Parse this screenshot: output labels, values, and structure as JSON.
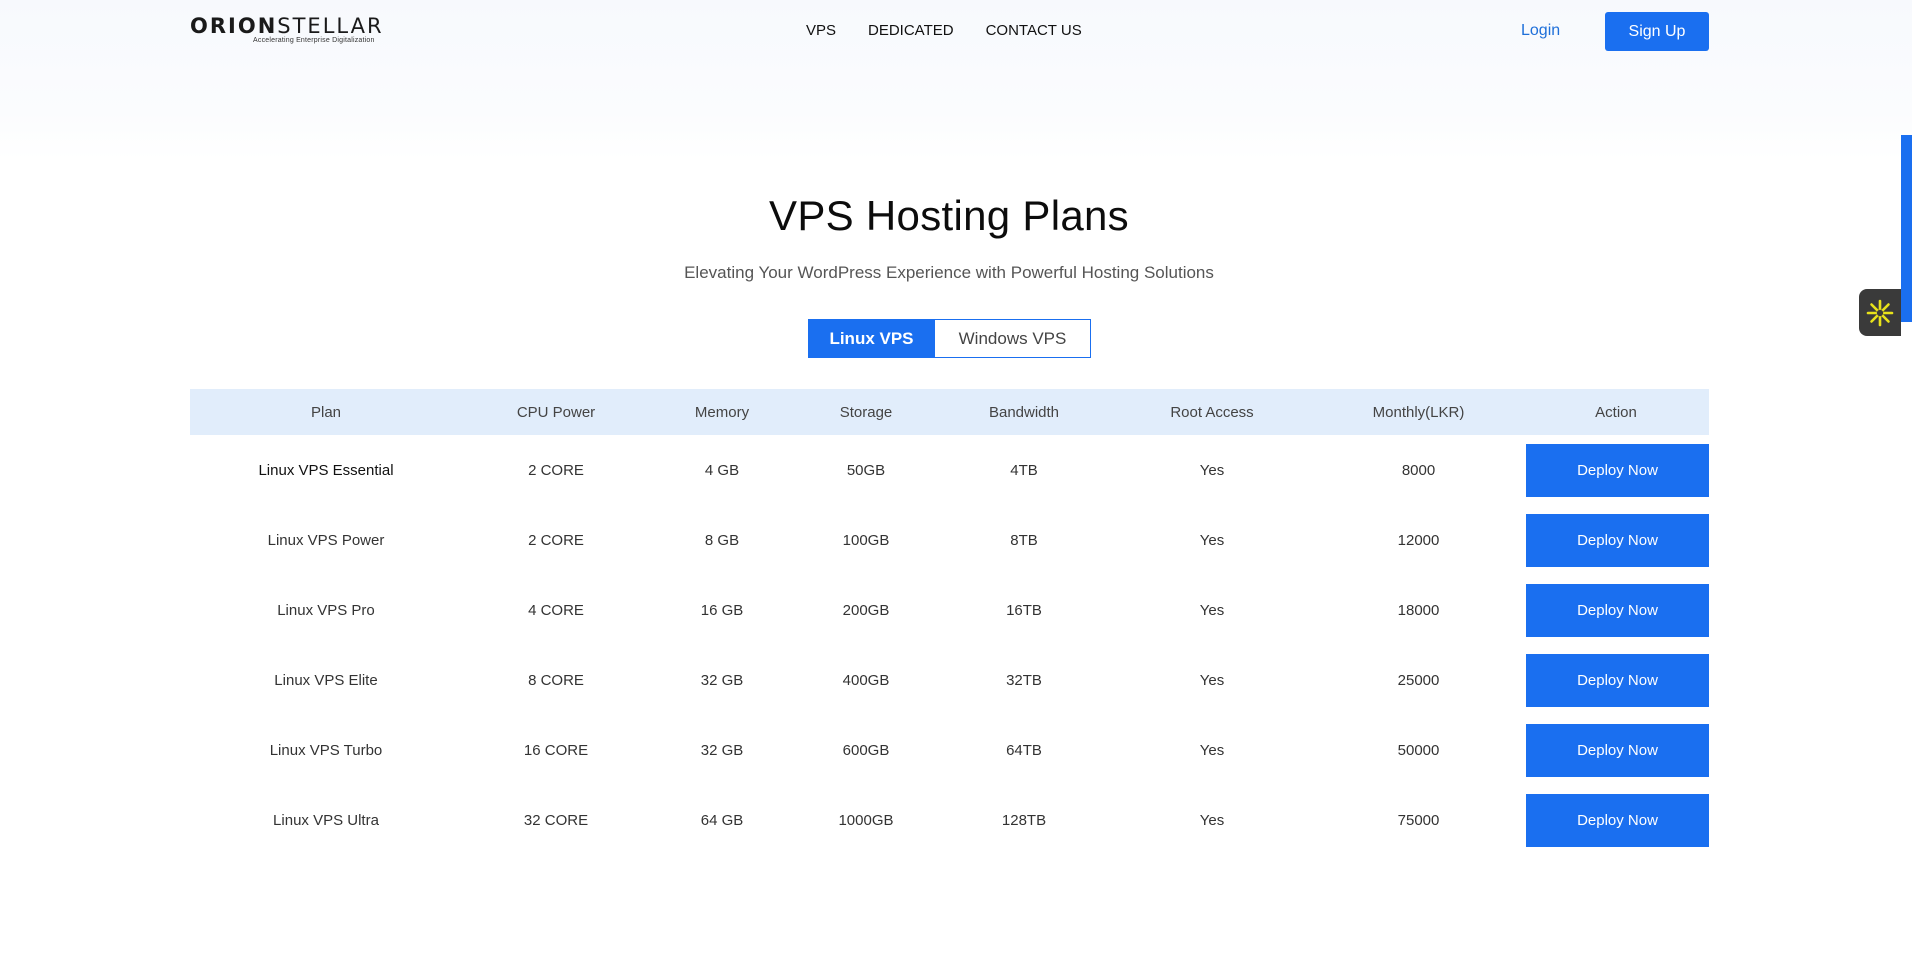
{
  "header": {
    "logo_bold": "ORION",
    "logo_light": "STELLAR",
    "logo_tagline": "Accelerating Enterprise Digitalization",
    "nav": [
      "VPS",
      "DEDICATED",
      "CONTACT US"
    ],
    "login": "Login",
    "signup": "Sign Up"
  },
  "hero": {
    "title": "VPS Hosting Plans",
    "subtitle": "Elevating Your WordPress Experience with Powerful Hosting Solutions"
  },
  "tabs": {
    "active": "Linux VPS",
    "inactive": "Windows VPS"
  },
  "table": {
    "headers": [
      "Plan",
      "CPU Power",
      "Memory",
      "Storage",
      "Bandwidth",
      "Root Access",
      "Monthly(LKR)",
      "Action"
    ],
    "rows": [
      {
        "plan": "Linux VPS Essential",
        "cpu": "2 CORE",
        "memory": "4 GB",
        "storage": "50GB",
        "bandwidth": "4TB",
        "root": "Yes",
        "price": "8000",
        "action": "Deploy Now"
      },
      {
        "plan": "Linux VPS Power",
        "cpu": "2 CORE",
        "memory": "8 GB",
        "storage": "100GB",
        "bandwidth": "8TB",
        "root": "Yes",
        "price": "12000",
        "action": "Deploy Now"
      },
      {
        "plan": "Linux VPS Pro",
        "cpu": "4 CORE",
        "memory": "16 GB",
        "storage": "200GB",
        "bandwidth": "16TB",
        "root": "Yes",
        "price": "18000",
        "action": "Deploy Now"
      },
      {
        "plan": "Linux VPS Elite",
        "cpu": "8 CORE",
        "memory": "32 GB",
        "storage": "400GB",
        "bandwidth": "32TB",
        "root": "Yes",
        "price": "25000",
        "action": "Deploy Now"
      },
      {
        "plan": "Linux VPS Turbo",
        "cpu": "16 CORE",
        "memory": "32 GB",
        "storage": "600GB",
        "bandwidth": "64TB",
        "root": "Yes",
        "price": "50000",
        "action": "Deploy Now"
      },
      {
        "plan": "Linux VPS Ultra",
        "cpu": "32 CORE",
        "memory": "64 GB",
        "storage": "1000GB",
        "bandwidth": "128TB",
        "root": "Yes",
        "price": "75000",
        "action": "Deploy Now"
      }
    ]
  },
  "widgets": {
    "side_widget_icon": "asterisk-icon",
    "accent_color": "#1a6ff0",
    "header_row_color": "#e1edfb",
    "widget_icon_color": "#e8e21a"
  }
}
